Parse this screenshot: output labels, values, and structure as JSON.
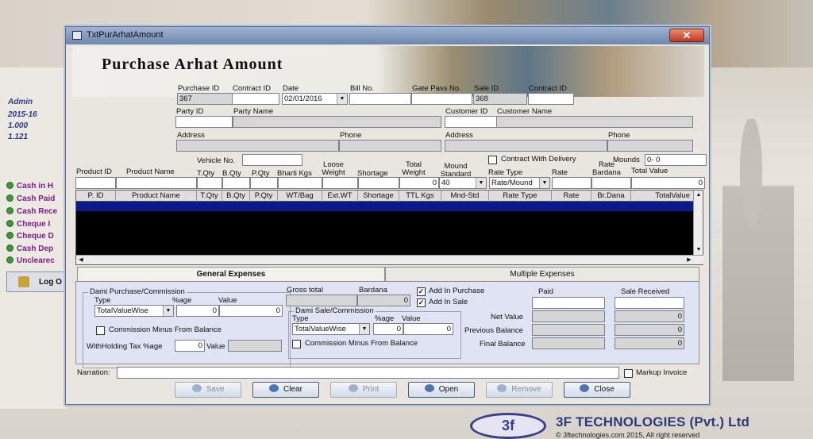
{
  "background": {
    "user": "Admin",
    "year": "2015-16",
    "version1": "1.000",
    "version2": "1.121",
    "side_links": [
      "Cash in H",
      "Cash Paid",
      "Cash Rece",
      "Cheque I",
      "Cheque D",
      "Cash Dep",
      "Unclearec"
    ],
    "logout_label": "Log O",
    "footer_brand": "3F TECHNOLOGIES (Pvt.) Ltd",
    "footer_copy": "© 3ftechnologies.com 2015, All right reserved",
    "footer_logo": "3f"
  },
  "window": {
    "title": "TxtPurArhatAmount",
    "close": "✕",
    "heading": "Purchase Arhat Amount"
  },
  "top_fields": {
    "purchase_id_label": "Purchase ID",
    "purchase_id": "367",
    "contract_id_label": "Contract ID",
    "contract_id": "",
    "date_label": "Date",
    "date": "02/01/2016",
    "bill_no_label": "Bill No.",
    "bill_no": "",
    "gate_pass_label": "Gate Pass No.",
    "gate_pass": "",
    "sale_id_label": "Sale ID",
    "sale_id": "368",
    "contract_id2_label": "Contract ID",
    "contract_id2": "",
    "party_id_label": "Party ID",
    "party_name_label": "Party Name",
    "customer_id_label": "Customer ID",
    "customer_name_label": "Customer Name",
    "address_label": "Address",
    "phone_label": "Phone",
    "address2_label": "Address",
    "phone2_label": "Phone",
    "contract_with_delivery": "Contract With Delivery",
    "mounds_label": "Mounds",
    "mounds": "0- 0"
  },
  "line_entry": {
    "vehicle_no_label": "Vehicle No.",
    "product_id": "Product ID",
    "product_name": "Product Name",
    "tqty": "T.Qty",
    "bqty": "B.Qty",
    "pqty": "P.Qty",
    "bharti": "Bharti Kgs",
    "loose": "Loose Weight",
    "shortage": "Shortage",
    "total_weight": "Total Weight",
    "mound_std": "Mound Standard",
    "rate_type": "Rate Type",
    "rate": "Rate",
    "rate_bardana": "Rate Bardana",
    "total_value": "Total Value",
    "total_weight_val": "0",
    "mound_std_val": "40",
    "rate_type_val": "Rate/Mound",
    "total_value_val": "0"
  },
  "grid": {
    "columns": [
      "P. ID",
      "Product Name",
      "T.Qty",
      "B.Qty",
      "P.Qty",
      "WT/Bag",
      "Ext.WT",
      "Shortage",
      "TTL Kgs",
      "Mnd-Std",
      "Rate Type",
      "Rate",
      "Br.Dana",
      "TotalValue"
    ]
  },
  "tabs": {
    "general": "General Expenses",
    "multiple": "Multiple Expenses"
  },
  "expenses": {
    "dami_purchase_title": "Dami Purchase/Commission",
    "type_label": "Type",
    "age_label": "%age",
    "value_label": "Value",
    "type_val": "TotalValueWise",
    "age_val": "0",
    "value_val": "0",
    "comm_minus": "Commission Minus From Balance",
    "withholding_label": "WithHolding Tax %age",
    "withholding_val": "0",
    "wh_value_label": "Value",
    "gross_total_label": "Gross total",
    "bardana_label": "Bardana",
    "bardana_val": "0",
    "dami_sale_title": "Dami Sale/Commission",
    "sale_type_val": "TotalValueWise",
    "sale_age_val": "0",
    "sale_value_val": "0",
    "sale_comm_minus": "Commission Minus From Balance",
    "add_in_purchase": "Add In Purchase",
    "add_in_sale": "Add In Sale",
    "paid_label": "Paid",
    "sale_received_label": "Sale Received",
    "net_value_label": "Net Value",
    "net_value_val": "0",
    "prev_balance_label": "Previous Balance",
    "prev_balance_val": "0",
    "final_balance_label": "Final Balance",
    "final_balance_val": "0"
  },
  "bottom": {
    "narration_label": "Narration:",
    "markup_invoice": "Markup Invoice",
    "save": "Save",
    "clear": "Clear",
    "print": "Print",
    "open": "Open",
    "remove": "Remove",
    "close": "Close"
  }
}
